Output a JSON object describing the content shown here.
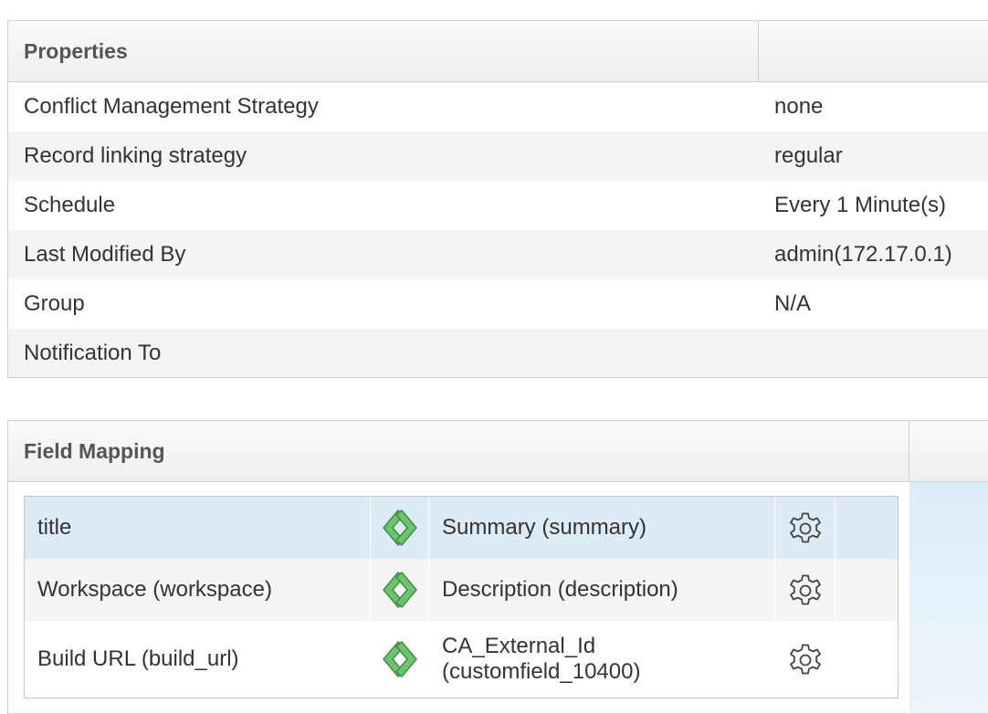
{
  "properties": {
    "header": "Properties",
    "rows": [
      {
        "key": "Conflict Management Strategy",
        "value": "none"
      },
      {
        "key": "Record linking strategy",
        "value": "regular"
      },
      {
        "key": "Schedule",
        "value": "Every 1 Minute(s)"
      },
      {
        "key": "Last Modified By",
        "value": "admin(172.17.0.1)"
      },
      {
        "key": "Group",
        "value": "N/A"
      },
      {
        "key": "Notification To",
        "value": ""
      }
    ]
  },
  "field_mapping": {
    "header": "Field Mapping",
    "rows": [
      {
        "source": "title",
        "target_line1": "Summary (summary)",
        "target_line2": ""
      },
      {
        "source": "Workspace (workspace)",
        "target_line1": "Description (description)",
        "target_line2": ""
      },
      {
        "source": "Build URL (build_url)",
        "target_line1": "CA_External_Id",
        "target_line2": "(customfield_10400)"
      }
    ],
    "icons": {
      "sync": "bidirectional-sync-icon",
      "settings": "gear-icon"
    },
    "colors": {
      "sync_green": "#5cb85c",
      "selected_row": "#dcebf6"
    }
  }
}
